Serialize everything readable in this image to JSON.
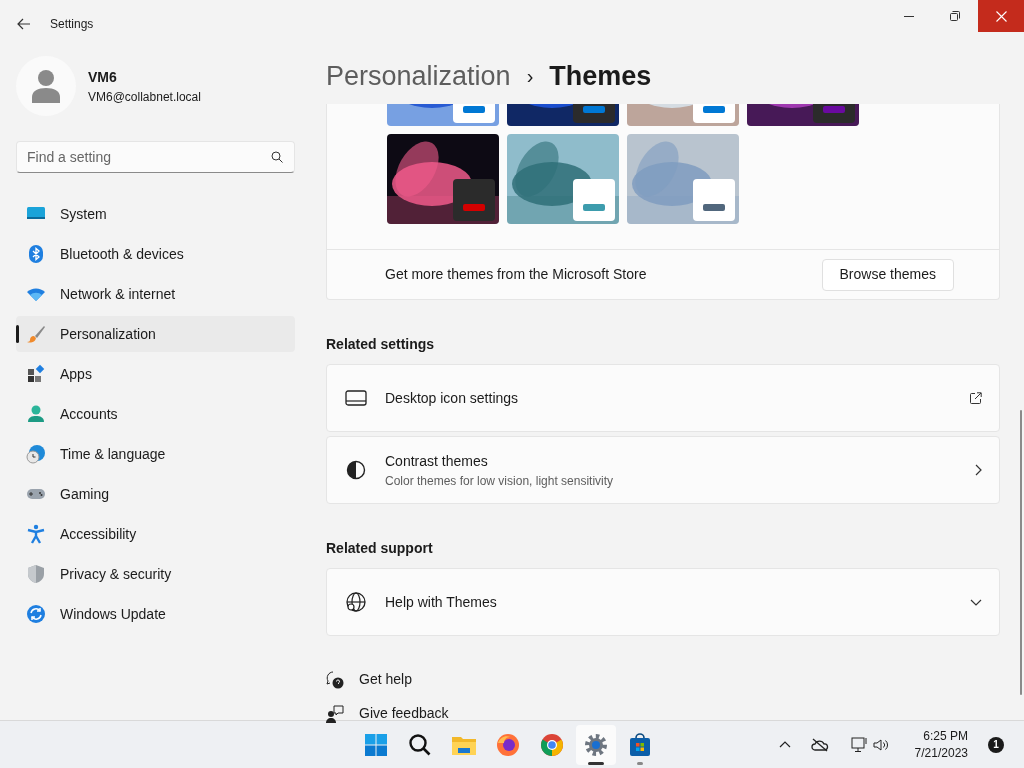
{
  "window": {
    "title": "Settings"
  },
  "user": {
    "name": "VM6",
    "email": "VM6@collabnet.local"
  },
  "search": {
    "placeholder": "Find a setting"
  },
  "nav": [
    {
      "kind": "system",
      "label": "System",
      "selected": false
    },
    {
      "kind": "bluetooth",
      "label": "Bluetooth & devices",
      "selected": false
    },
    {
      "kind": "network",
      "label": "Network & internet",
      "selected": false
    },
    {
      "kind": "personalization",
      "label": "Personalization",
      "selected": true
    },
    {
      "kind": "apps",
      "label": "Apps",
      "selected": false
    },
    {
      "kind": "accounts",
      "label": "Accounts",
      "selected": false
    },
    {
      "kind": "time",
      "label": "Time & language",
      "selected": false
    },
    {
      "kind": "gaming",
      "label": "Gaming",
      "selected": false
    },
    {
      "kind": "accessibility",
      "label": "Accessibility",
      "selected": false
    },
    {
      "kind": "privacy",
      "label": "Privacy & security",
      "selected": false
    },
    {
      "kind": "update",
      "label": "Windows Update",
      "selected": false
    }
  ],
  "breadcrumb": {
    "parent": "Personalization",
    "separator": "›",
    "current": "Themes"
  },
  "store_row": {
    "text": "Get more themes from the Microsoft Store",
    "button": "Browse themes"
  },
  "related_settings": {
    "heading": "Related settings",
    "items": [
      {
        "kind": "desktop",
        "title": "Desktop icon settings",
        "opens_externally": true
      },
      {
        "kind": "contrast",
        "title": "Contrast themes",
        "subtitle": "Color themes for low vision, light sensitivity",
        "opens_externally": false
      }
    ]
  },
  "related_support": {
    "heading": "Related support",
    "items": [
      {
        "kind": "globe",
        "title": "Help with Themes",
        "expanded": false
      }
    ]
  },
  "footer_links": [
    {
      "kind": "help",
      "label": "Get help"
    },
    {
      "kind": "feedback",
      "label": "Give feedback"
    }
  ],
  "taskbar": {
    "apps": [
      {
        "kind": "start",
        "active": false
      },
      {
        "kind": "search",
        "active": false
      },
      {
        "kind": "explorer",
        "active": false
      },
      {
        "kind": "firefox",
        "active": false
      },
      {
        "kind": "chrome",
        "active": false
      },
      {
        "kind": "settings",
        "active": true
      },
      {
        "kind": "store",
        "active": false
      }
    ],
    "time": "6:25 PM",
    "date": "7/21/2023",
    "notifications": "1"
  }
}
